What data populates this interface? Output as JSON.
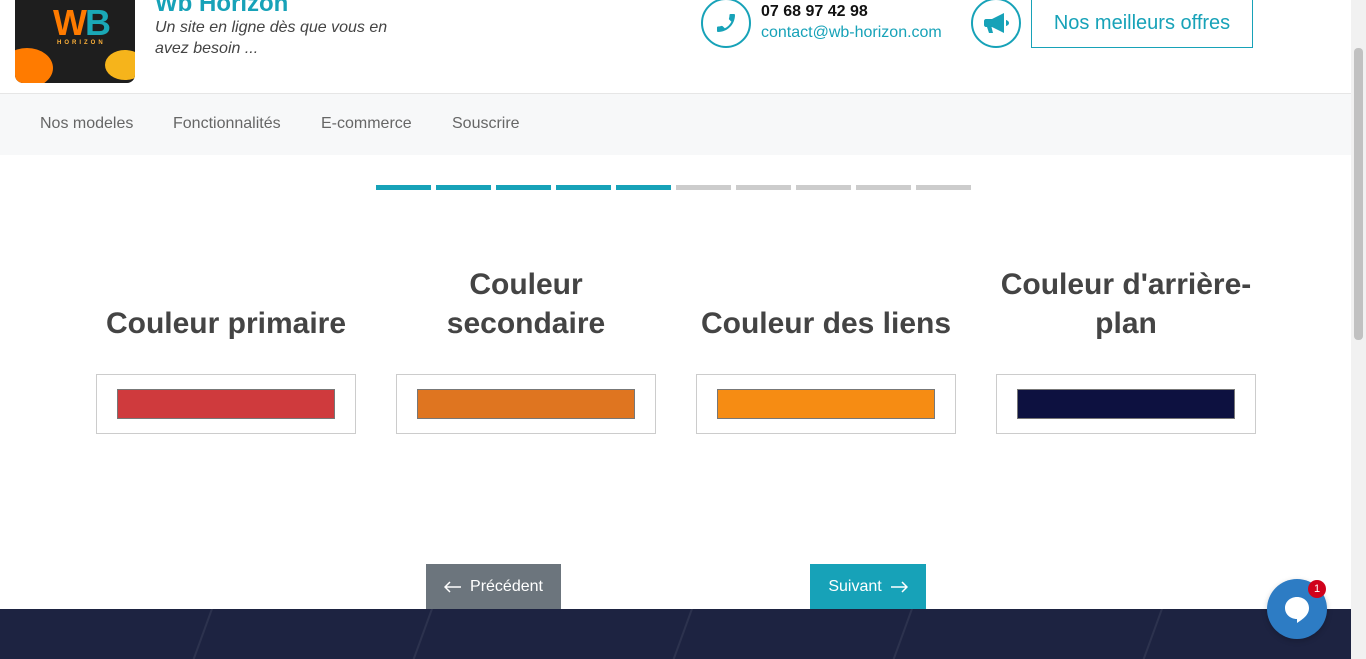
{
  "header": {
    "logo_text_w": "W",
    "logo_text_b": "B",
    "logo_sub": "HORIZON",
    "brand_title": "Wb Horizon",
    "tagline": "Un site en ligne dès que vous en avez besoin ...",
    "phone": "07 68 97 42 98",
    "email": "contact@wb-horizon.com",
    "offers_label": "Nos meilleurs offres",
    "accent_color": "#17a2b8"
  },
  "nav": {
    "items": [
      {
        "label": "Nos modeles"
      },
      {
        "label": "Fonctionnalités"
      },
      {
        "label": "E-commerce"
      },
      {
        "label": "Souscrire"
      }
    ]
  },
  "progress": {
    "total_steps": 10,
    "completed_steps": 5,
    "active_color": "#17a2b8",
    "inactive_color": "#cccccc"
  },
  "colors": [
    {
      "title": "Couleur primaire",
      "value": "#cf3a3d"
    },
    {
      "title": "Couleur secondaire",
      "value": "#df7520"
    },
    {
      "title": "Couleur des liens",
      "value": "#f68c13"
    },
    {
      "title": "Couleur d'arrière-plan",
      "value": "#0d1140"
    }
  ],
  "buttons": {
    "prev_label": "Précédent",
    "next_label": "Suivant"
  },
  "chat": {
    "badge_count": "1"
  }
}
